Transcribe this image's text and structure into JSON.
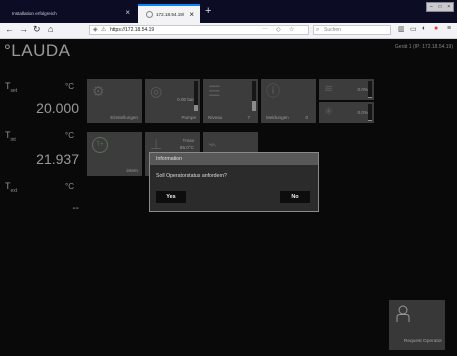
{
  "browser": {
    "tabs": [
      {
        "title": "Installation erfolgreich",
        "close": "×"
      },
      {
        "title": "172.18.54.19/",
        "close": "×"
      }
    ],
    "new_tab": "+",
    "url": "https://172.18.54.19",
    "url_actions": "···",
    "search_placeholder": "Suchen",
    "window_controls": [
      "–",
      "□",
      "×"
    ]
  },
  "app": {
    "logo": "°LAUDA",
    "device_info": "Gerät 1 (IP: 172.18.54.19)",
    "temps": [
      {
        "label": "T",
        "sub": "set",
        "unit": "°C",
        "value": "20.000"
      },
      {
        "label": "T",
        "sub": "int",
        "unit": "°C",
        "value": "21.937"
      },
      {
        "label": "T",
        "sub": "ext",
        "unit": "°C",
        "value": "--"
      }
    ],
    "tiles": {
      "settings": {
        "label": "Einstellungen"
      },
      "pump": {
        "label": "Pumpe",
        "value": "0.00 bar",
        "level": 0.2
      },
      "level": {
        "label": "Niveau",
        "count": "7",
        "level": 0.35
      },
      "messages": {
        "label": "Meldungen",
        "count": "0"
      },
      "heating": {
        "value": "0.0%",
        "level": 0.05
      },
      "cooling": {
        "value": "0.0%",
        "level": 0.05
      },
      "control": {
        "label": "intern",
        "badge": "T+"
      },
      "limit": {
        "value1": "Tmax",
        "value2": "85.0°C"
      }
    },
    "request_operator": "Request Operator"
  },
  "dialog": {
    "title": "Information",
    "message": "Soll Operatorstatus anfordern?",
    "yes": "Yes",
    "no": "No"
  }
}
